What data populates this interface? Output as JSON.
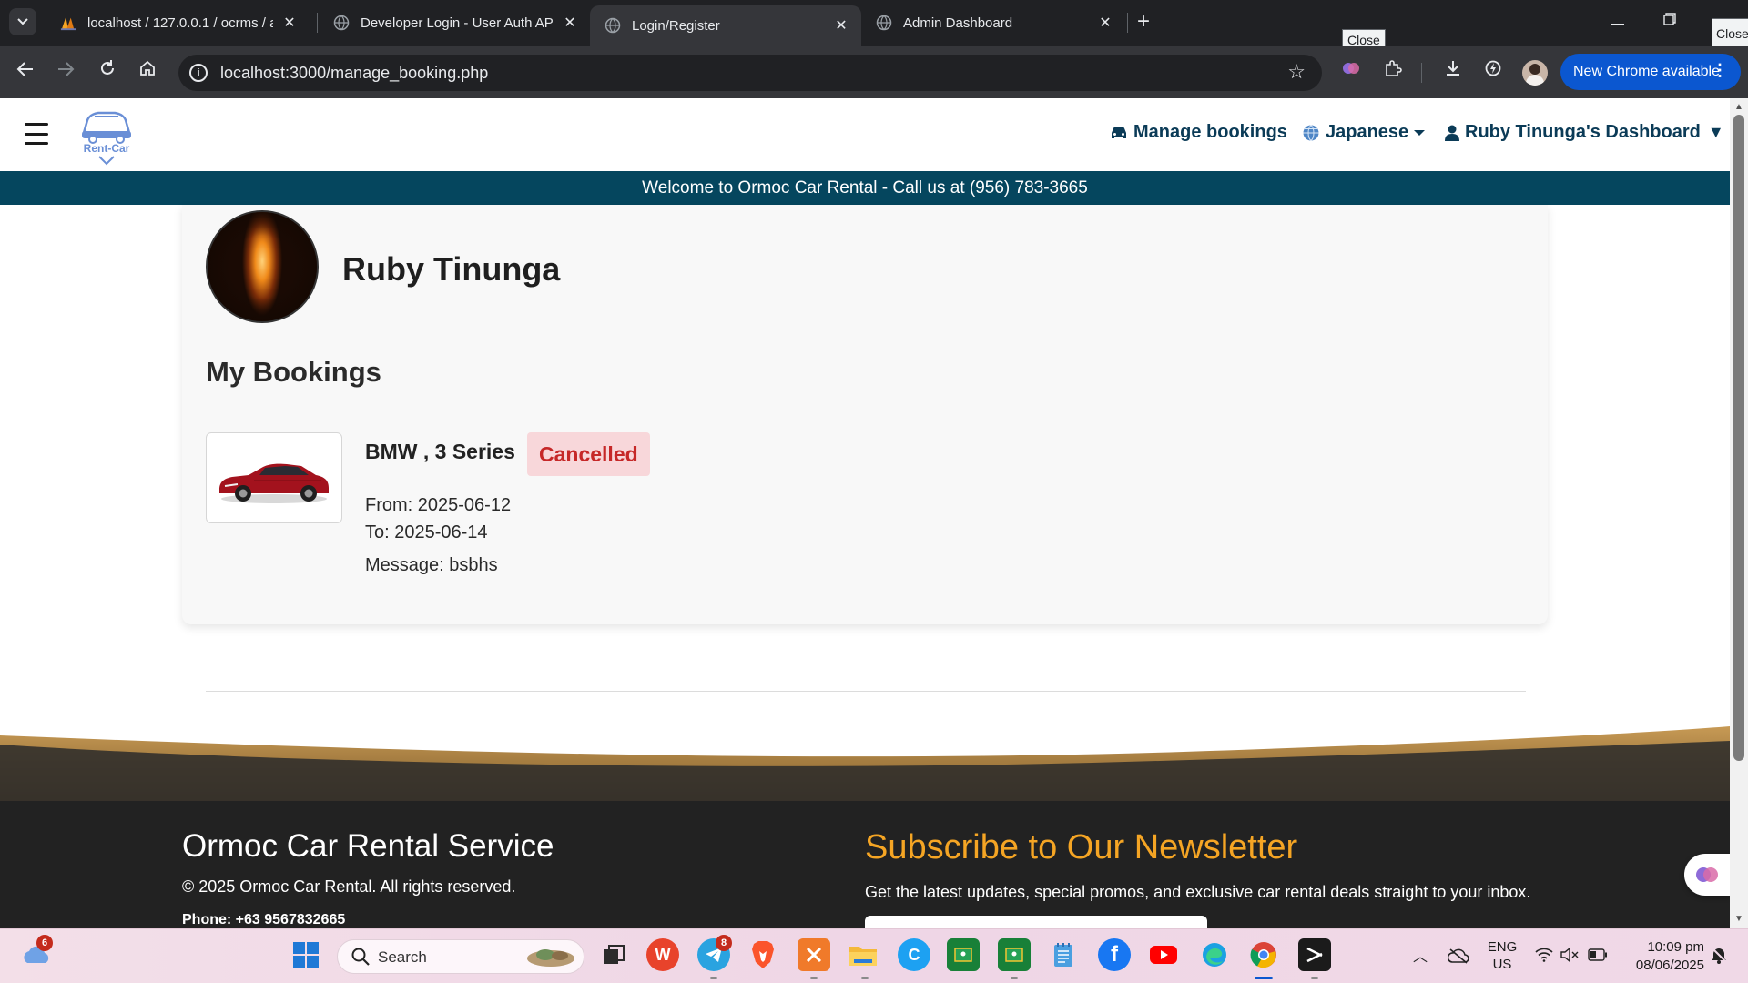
{
  "browser": {
    "tabs": [
      {
        "title": "localhost / 127.0.0.1 / ocrms / a",
        "active": false
      },
      {
        "title": "Developer Login - User Auth AP",
        "active": false
      },
      {
        "title": "Login/Register",
        "active": true
      },
      {
        "title": "Admin Dashboard",
        "active": false
      }
    ],
    "tooltip_close_1": "Close",
    "tooltip_close_2": "Close",
    "url": "localhost:3000/manage_booking.php",
    "update_button": "New Chrome available"
  },
  "site": {
    "logo_text": "Rent-Car",
    "nav": {
      "manage_bookings": "Manage bookings",
      "language": "Japanese",
      "dashboard": "Ruby Tinunga's Dashboard"
    },
    "welcome_banner": "Welcome to Ormoc Car Rental - Call us at (956) 783-3665",
    "profile": {
      "name": "Ruby Tinunga"
    },
    "bookings_title": "My Bookings",
    "bookings": [
      {
        "car": "BMW , 3 Series",
        "status": "Cancelled",
        "from": "From: 2025-06-12",
        "to": "To: 2025-06-14",
        "message": "Message: bsbhs"
      }
    ],
    "footer": {
      "title": "Ormoc Car Rental Service",
      "copyright": "© 2025 Ormoc Car Rental. All rights reserved.",
      "phone": "Phone: +63 9567832665",
      "newsletter_title": "Subscribe to Our Newsletter",
      "newsletter_text": "Get the latest updates, special promos, and exclusive car rental deals straight to your inbox."
    }
  },
  "taskbar": {
    "weather_badge": "6",
    "search_placeholder": "Search",
    "telegram_badge": "8",
    "lang_line1": "ENG",
    "lang_line2": "US",
    "time": "10:09 pm",
    "date": "08/06/2025"
  },
  "colors": {
    "brand_dark_teal": "#05465e",
    "nav_text": "#0b3b57",
    "badge_bg": "#f8d7da",
    "badge_text": "#c62828",
    "newsletter_accent": "#f5a524",
    "chrome_update": "#0b57d0"
  }
}
